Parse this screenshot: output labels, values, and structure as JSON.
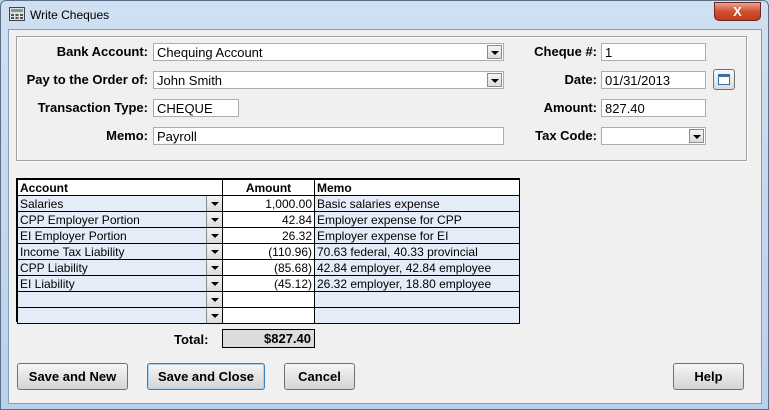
{
  "window": {
    "title": "Write Cheques",
    "close_glyph": "X"
  },
  "form": {
    "bank_account_label": "Bank Account:",
    "bank_account_value": "Chequing Account",
    "pay_to_label": "Pay to the Order of:",
    "pay_to_value": "John Smith",
    "transaction_type_label": "Transaction Type:",
    "transaction_type_value": "CHEQUE",
    "memo_label": "Memo:",
    "memo_value": "Payroll",
    "cheque_no_label": "Cheque #:",
    "cheque_no_value": "1",
    "date_label": "Date:",
    "date_value": "01/31/2013",
    "amount_label": "Amount:",
    "amount_value": "827.40",
    "tax_code_label": "Tax Code:",
    "tax_code_value": ""
  },
  "grid": {
    "headers": {
      "account": "Account",
      "amount": "Amount",
      "memo": "Memo"
    },
    "rows": [
      {
        "account": "Salaries",
        "amount": "1,000.00",
        "memo": "Basic salaries expense"
      },
      {
        "account": "CPP Employer Portion",
        "amount": "42.84",
        "memo": "Employer expense for CPP"
      },
      {
        "account": "EI Employer Portion",
        "amount": "26.32",
        "memo": "Employer expense for EI"
      },
      {
        "account": "Income Tax Liability",
        "amount": "(110.96)",
        "memo": "70.63 federal, 40.33 provincial"
      },
      {
        "account": "CPP Liability",
        "amount": "(85.68)",
        "memo": "42.84 employer, 42.84 employee"
      },
      {
        "account": "EI Liability",
        "amount": "(45.12)",
        "memo": "26.32 employer, 18.80 employee"
      },
      {
        "account": "",
        "amount": "",
        "memo": ""
      },
      {
        "account": "",
        "amount": "",
        "memo": ""
      }
    ]
  },
  "total": {
    "label": "Total:",
    "value": "$827.40"
  },
  "buttons": {
    "save_new": "Save and New",
    "save_close": "Save and Close",
    "cancel": "Cancel",
    "help": "Help"
  }
}
